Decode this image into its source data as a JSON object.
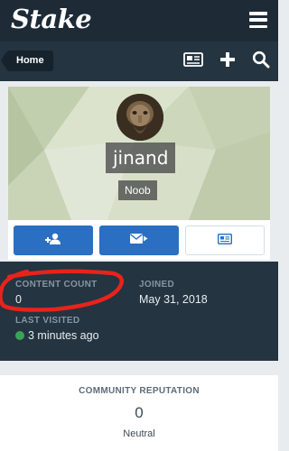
{
  "header": {
    "logo_text": "Stake",
    "menu_icon": "hamburger-menu-icon"
  },
  "subbar": {
    "breadcrumb_label": "Home",
    "icons": [
      "newspaper-icon",
      "plus-icon",
      "search-icon"
    ]
  },
  "profile": {
    "username": "jinand",
    "rank": "Noob",
    "avatar": "avatar-image",
    "buttons": [
      "follow-user-icon",
      "message-icon",
      "feed-card-icon"
    ]
  },
  "stats": {
    "content_count_label": "CONTENT COUNT",
    "content_count_value": "0",
    "joined_label": "JOINED",
    "joined_value": "May 31, 2018",
    "last_visited_label": "LAST VISITED",
    "last_visited_value": "3 minutes ago",
    "online_color": "#3aa456"
  },
  "reputation": {
    "title": "COMMUNITY REPUTATION",
    "value": "0",
    "standing": "Neutral"
  },
  "colors": {
    "header_bg": "#1e2b36",
    "accent_blue": "#2a6fc1",
    "annotation_red": "#e8231b"
  }
}
